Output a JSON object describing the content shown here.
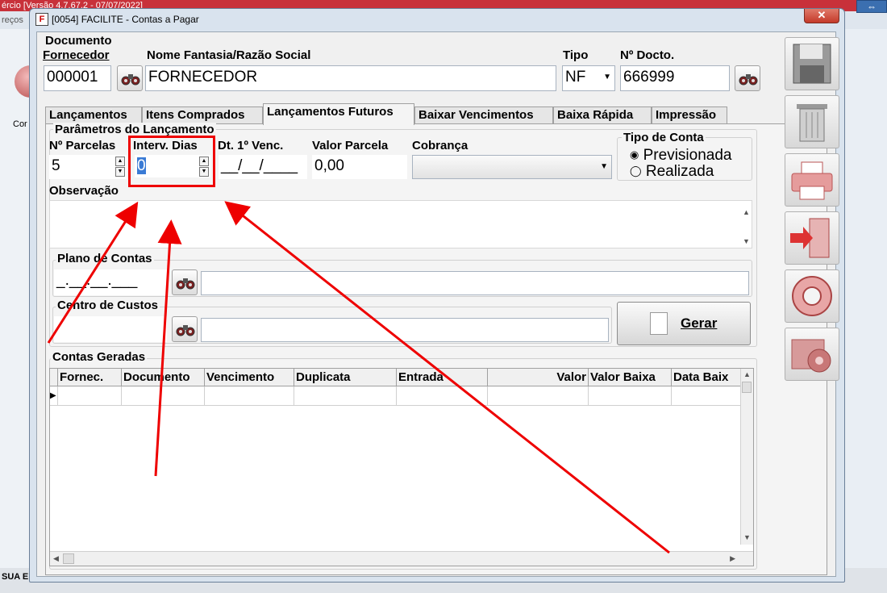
{
  "background": {
    "title": "ércio [Versão 4.7.67.2 - 07/07/2022]",
    "menu_left": "reços",
    "side_label": "Cor",
    "status_text": "SUA E"
  },
  "window": {
    "id_code": "[0054]",
    "title": "[0054] FACILITE - Contas a Pagar",
    "close_label": "✕"
  },
  "document": {
    "section_label": "Documento",
    "supplier_label": "Fornecedor",
    "supplier_code": "000001",
    "name_label": "Nome Fantasia/Razão Social",
    "name_value": "FORNECEDOR",
    "type_label": "Tipo",
    "type_value": "NF",
    "doc_no_label": "Nº Docto.",
    "doc_no_value": "666999"
  },
  "tabs": [
    {
      "label": "Lançamentos",
      "active": false
    },
    {
      "label": "Itens Comprados",
      "active": false
    },
    {
      "label": "Lançamentos Futuros",
      "active": true
    },
    {
      "label": "Baixar Vencimentos",
      "active": false
    },
    {
      "label": "Baixa Rápida",
      "active": false
    },
    {
      "label": "Impressão",
      "active": false
    }
  ],
  "params": {
    "title": "Parâmetros do Lançamento",
    "installments_label": "Nº Parcelas",
    "installments_value": "5",
    "interval_label": "Interv. Dias",
    "interval_value": "0",
    "first_due_label": "Dt. 1º Venc.",
    "first_due_value": "__/__/____",
    "installment_value_label": "Valor Parcela",
    "installment_value": "0,00",
    "billing_label": "Cobrança",
    "billing_value": "",
    "account_type_title": "Tipo de Conta",
    "account_type_options": [
      "Previsionada",
      "Realizada"
    ],
    "account_type_selected": "Previsionada",
    "notes_label": "Observação",
    "notes_value": ""
  },
  "chart_of_accounts": {
    "title": "Plano de Contas",
    "code_value": "_.__.__.___",
    "description": ""
  },
  "cost_center": {
    "title": "Centro de Custos",
    "code_value": "",
    "description": ""
  },
  "generate_button": "Gerar",
  "generated": {
    "title": "Contas Geradas",
    "columns": [
      "Fornec.",
      "Documento",
      "Vencimento",
      "Duplicata",
      "Entrada",
      "Valor",
      "Valor Baixa",
      "Data Baix"
    ],
    "rows": []
  },
  "side_toolbar": [
    "save-icon",
    "trash-icon",
    "printer-icon",
    "exit-door-icon",
    "lifebuoy-icon",
    "folder-gear-icon"
  ],
  "colors": {
    "accent_red": "#e00000",
    "window_blue": "#d9e3ee"
  }
}
